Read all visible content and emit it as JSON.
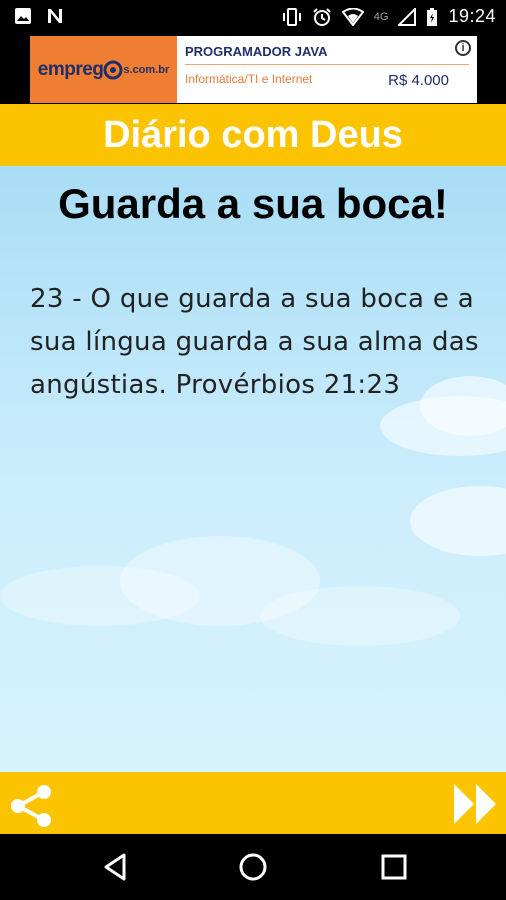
{
  "status_bar": {
    "time": "19:24",
    "network": "4G",
    "icons": [
      "image-icon",
      "n-icon",
      "vibrate-icon",
      "alarm-icon",
      "wifi-icon",
      "signal-icon",
      "battery-icon"
    ]
  },
  "ad": {
    "logo_text": "empreg",
    "logo_suffix": "s.com.br",
    "title": "PROGRAMADOR JAVA",
    "subtitle": "Informática/TI e Internet",
    "price": "R$ 4.000",
    "info_label": "i"
  },
  "header": {
    "title": "Diário com Deus"
  },
  "content": {
    "title": "Guarda a sua boca!",
    "verse": "23 - O que guarda a sua boca e a sua língua guarda a sua alma das angústias. Provérbios 21:23"
  },
  "toolbar": {
    "share_icon": "share-icon",
    "next_icon": "fast-forward-icon"
  },
  "colors": {
    "accent": "#fcc400",
    "sky_top": "#a9ddf5",
    "sky_bottom": "#d6f2fd",
    "ad_orange": "#ef7d32"
  }
}
